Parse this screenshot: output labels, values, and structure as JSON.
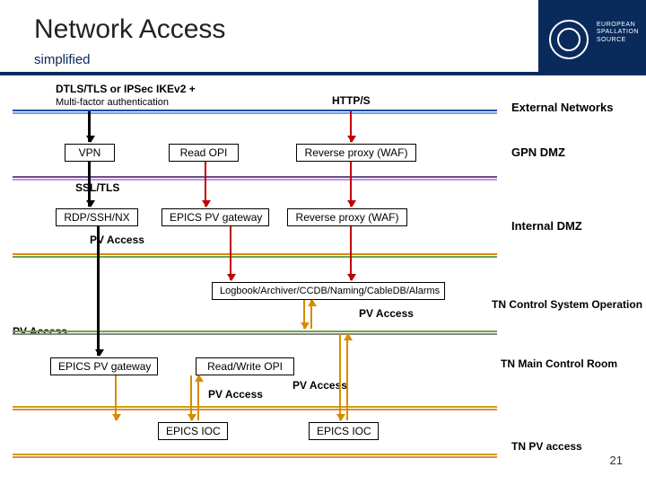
{
  "header": {
    "title": "Network Access",
    "subtitle": "simplified",
    "logo_text_1": "EUROPEAN",
    "logo_text_2": "SPALLATION",
    "logo_text_3": "SOURCE"
  },
  "labels": {
    "dtls": "DTLS/TLS or IPSec IKEv2 +",
    "mfa": "Multi-factor authentication",
    "https": "HTTP/S",
    "ssl": "SSL/TLS",
    "pv_access": "PV Access"
  },
  "boxes": {
    "vpn": "VPN",
    "read_opi": "Read OPI",
    "rev_proxy": "Reverse proxy (WAF)",
    "rdp": "RDP/SSH/NX",
    "epics_gw": "EPICS PV gateway",
    "rev_proxy2": "Reverse proxy (WAF)",
    "logbook": "Logbook/Archiver/CCDB/Naming/CableDB/Alarms",
    "epics_gw2": "EPICS PV gateway",
    "rw_opi": "Read/Write OPI",
    "epics_ioc": "EPICS IOC"
  },
  "zones": {
    "ext": "External Networks",
    "gpn": "GPN DMZ",
    "int": "Internal DMZ",
    "tncs": "TN Control System Operation",
    "tnmcr": "TN Main Control Room",
    "tnpv": "TN PV access"
  },
  "page_number": "21",
  "colors": {
    "navy": "#0a2a5c",
    "red": "#c00000",
    "orange": "#d98a00"
  }
}
